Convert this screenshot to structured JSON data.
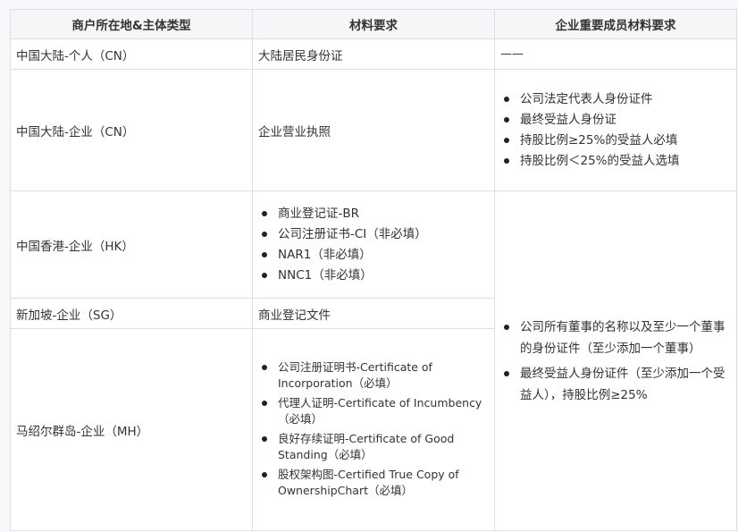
{
  "headers": [
    "商户所在地&主体类型",
    "材料要求",
    "企业重要成员材料要求"
  ],
  "rows": {
    "cn_person": {
      "location": "中国大陆-个人（CN）",
      "materials": "大陆居民身份证",
      "members": "——"
    },
    "cn_company": {
      "location": "中国大陆-企业（CN）",
      "materials": "企业营业执照",
      "members": [
        "公司法定代表人身份证件",
        "最终受益人身份证",
        "持股比例≥25%的受益人必填",
        "持股比例＜25%的受益人选填"
      ]
    },
    "hk_company": {
      "location": "中国香港-企业（HK）",
      "materials": [
        "商业登记证-BR",
        "公司注册证书-CI（非必填）",
        "NAR1（非必填）",
        "NNC1（非必填）"
      ]
    },
    "sg_company": {
      "location": "新加坡-企业（SG）",
      "materials": "商业登记文件"
    },
    "mh_company": {
      "location": "马绍尔群岛-企业（MH）",
      "materials": [
        "公司注册证明书-Certificate of Incorporation（必填）",
        "代理人证明-Certificate of Incumbency（必填）",
        "良好存续证明-Certificate of Good Standing（必填）",
        "股权架构图-Certified True Copy of OwnershipChart（必填）"
      ]
    },
    "shared_members": [
      "公司所有董事的名称以及至少一个董事的身份证件（至少添加一个董事）",
      "最终受益人身份证件（至少添加一个受益人），持股比例≥25%"
    ]
  }
}
